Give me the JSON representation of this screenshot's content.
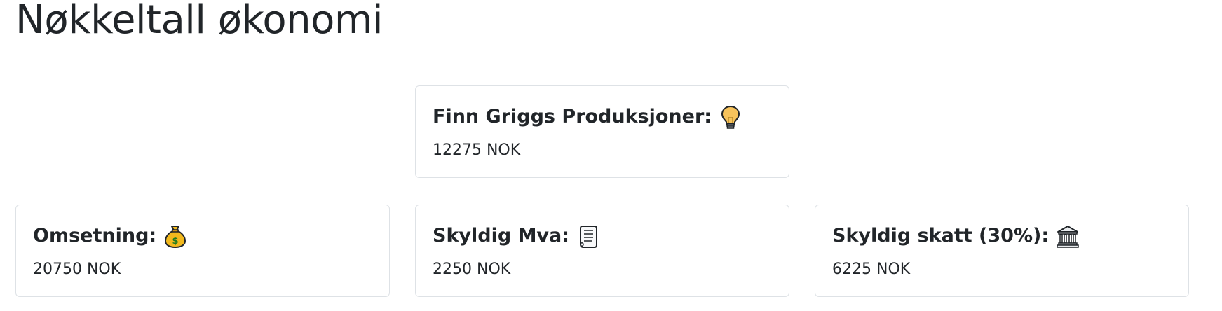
{
  "page": {
    "title": "Nøkkeltall økonomi"
  },
  "cards": {
    "company": {
      "label": "Finn Griggs Produksjoner:",
      "icon": "lightbulb-icon",
      "value": "12275 NOK"
    },
    "omsetning": {
      "label": "Omsetning:",
      "icon": "money-bag-icon",
      "value": "20750 NOK"
    },
    "mva": {
      "label": "Skyldig Mva:",
      "icon": "scroll-icon",
      "value": "2250 NOK"
    },
    "skatt": {
      "label": "Skyldig skatt (30%):",
      "icon": "bank-icon",
      "value": "6225 NOK"
    }
  },
  "colors": {
    "text": "#212529",
    "border": "#dee2e6",
    "divider": "#cfd2d5",
    "lightbulb": "#f7c35c",
    "money_bag": "#f2b91d"
  }
}
